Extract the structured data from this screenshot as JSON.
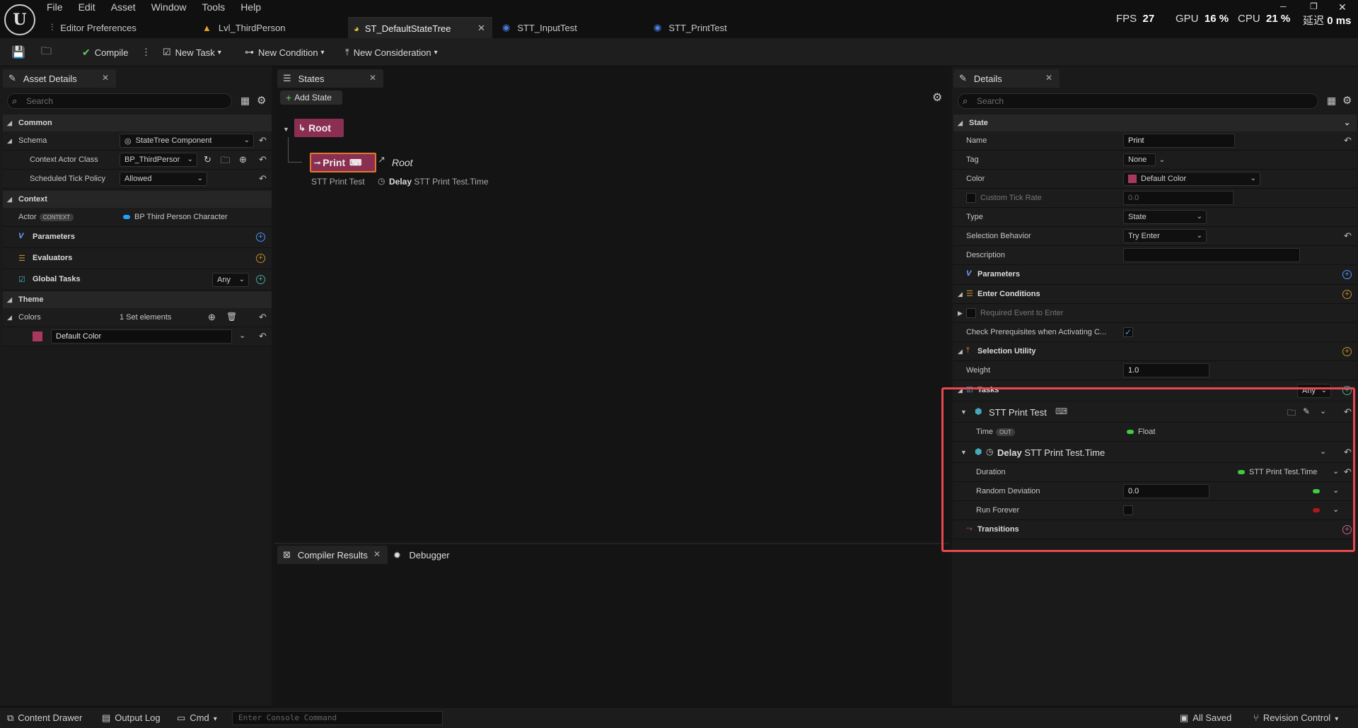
{
  "menu": [
    "File",
    "Edit",
    "Asset",
    "Window",
    "Tools",
    "Help"
  ],
  "tabs": {
    "editor_prefs": "Editor Preferences",
    "lvl": "Lvl_ThirdPerson",
    "st_default": "ST_DefaultStateTree",
    "stt_input": "STT_InputTest",
    "stt_print": "STT_PrintTest"
  },
  "stats": {
    "fps_label": "FPS",
    "fps": "27",
    "gpu_label": "GPU",
    "gpu": "16 %",
    "cpu_label": "CPU",
    "cpu": "21 %",
    "latency_label": "延迟",
    "latency": "0 ms"
  },
  "toolbar": {
    "compile": "Compile",
    "new_task": "New Task",
    "new_condition": "New Condition",
    "new_consideration": "New Consideration"
  },
  "asset_details": {
    "tab": "Asset Details",
    "search_placeholder": "Search",
    "common": "Common",
    "schema_label": "Schema",
    "schema_value": "StateTree Component",
    "context_actor_class_label": "Context Actor Class",
    "context_actor_class_value": "BP_ThirdPersor",
    "scheduled_tick_label": "Scheduled Tick Policy",
    "scheduled_tick_value": "Allowed",
    "context": "Context",
    "actor_label": "Actor",
    "actor_pill": "CONTEXT",
    "actor_value": "BP Third Person Character",
    "parameters": "Parameters",
    "evaluators": "Evaluators",
    "global_tasks": "Global Tasks",
    "global_tasks_any": "Any",
    "theme": "Theme",
    "colors_label": "Colors",
    "colors_value": "1 Set elements",
    "default_color": "Default Color"
  },
  "states": {
    "tab": "States",
    "add_state": "Add State",
    "root": "Root",
    "print": "Print",
    "link_root": "Root",
    "task1": "STT Print Test",
    "task2_bold": "Delay",
    "task2": "STT Print Test.Time"
  },
  "bottom_tabs": {
    "compiler": "Compiler Results",
    "debugger": "Debugger"
  },
  "details": {
    "tab": "Details",
    "search_placeholder": "Search",
    "state": "State",
    "name_label": "Name",
    "name_value": "Print",
    "tag_label": "Tag",
    "tag_value": "None",
    "color_label": "Color",
    "color_value": "Default Color",
    "custom_tick_label": "Custom Tick Rate",
    "custom_tick_value": "0.0",
    "type_label": "Type",
    "type_value": "State",
    "selection_label": "Selection Behavior",
    "selection_value": "Try Enter",
    "description_label": "Description",
    "parameters": "Parameters",
    "enter_conditions": "Enter Conditions",
    "required_event": "Required Event to Enter",
    "check_prereq": "Check Prerequisites when Activating C...",
    "selection_utility": "Selection Utility",
    "weight_label": "Weight",
    "weight_value": "1.0",
    "tasks": "Tasks",
    "tasks_any": "Any",
    "task1": "STT Print Test",
    "time_label": "Time",
    "time_pill": "OUT",
    "time_value": "Float",
    "task2_bold": "Delay",
    "task2": "STT Print Test.Time",
    "duration_label": "Duration",
    "duration_value": "STT Print Test.Time",
    "random_dev_label": "Random Deviation",
    "random_dev_value": "0.0",
    "run_forever_label": "Run Forever",
    "transitions": "Transitions"
  },
  "statusbar": {
    "content_drawer": "Content Drawer",
    "output_log": "Output Log",
    "cmd": "Cmd",
    "console_placeholder": "Enter Console Command",
    "all_saved": "All Saved",
    "revision": "Revision Control"
  },
  "colors": {
    "root_pink": "#8b2f52",
    "print_border": "#e07a2a",
    "highlight": "#e8484f",
    "accent_blue": "#4c93ff"
  }
}
